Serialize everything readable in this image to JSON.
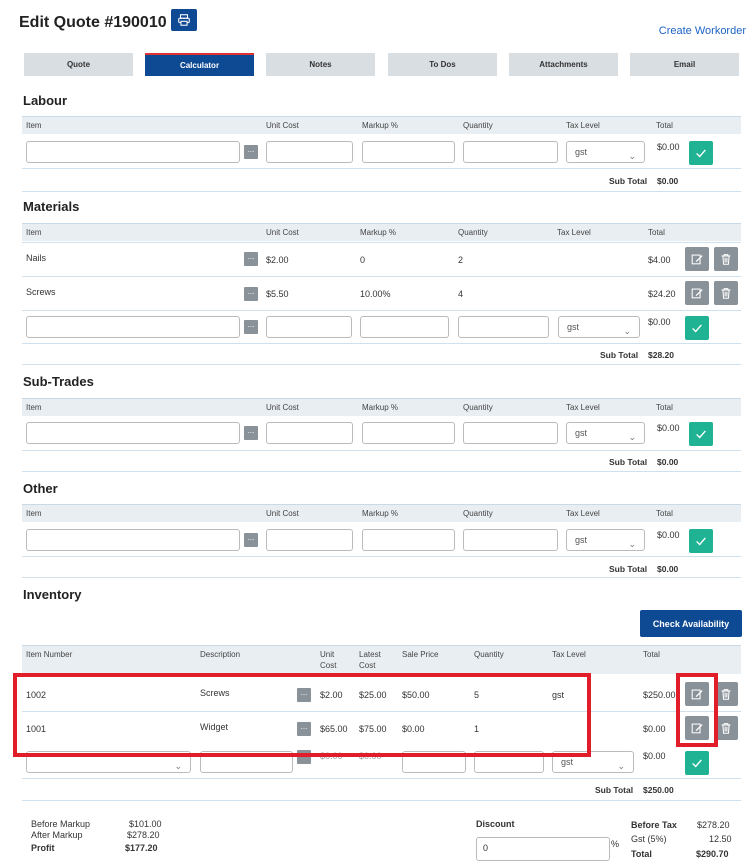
{
  "header": {
    "title": "Edit Quote #190010",
    "create_workorder": "Create Workorder"
  },
  "tabs": [
    "Quote",
    "Calculator",
    "Notes",
    "To Dos",
    "Attachments",
    "Email"
  ],
  "labour": {
    "title": "Labour",
    "cols": [
      "Item",
      "Unit Cost",
      "Markup %",
      "Quantity",
      "Tax Level",
      "Total"
    ],
    "new_row": {
      "tax": "gst",
      "total": "$0.00"
    },
    "subtotal_label": "Sub Total",
    "subtotal": "$0.00"
  },
  "materials": {
    "title": "Materials",
    "cols": [
      "Item",
      "Unit Cost",
      "Markup %",
      "Quantity",
      "Tax Level",
      "Total"
    ],
    "rows": [
      {
        "item": "Nails",
        "unit_cost": "$2.00",
        "markup": "0",
        "qty": "2",
        "total": "$4.00"
      },
      {
        "item": "Screws",
        "unit_cost": "$5.50",
        "markup": "10.00%",
        "qty": "4",
        "total": "$24.20"
      }
    ],
    "new_row": {
      "tax": "gst",
      "total": "$0.00"
    },
    "subtotal_label": "Sub Total",
    "subtotal": "$28.20"
  },
  "subtrades": {
    "title": "Sub-Trades",
    "cols": [
      "Item",
      "Unit Cost",
      "Markup %",
      "Quantity",
      "Tax Level",
      "Total"
    ],
    "new_row": {
      "tax": "gst",
      "total": "$0.00"
    },
    "subtotal_label": "Sub Total",
    "subtotal": "$0.00"
  },
  "other": {
    "title": "Other",
    "cols": [
      "Item",
      "Unit Cost",
      "Markup %",
      "Quantity",
      "Tax Level",
      "Total"
    ],
    "new_row": {
      "tax": "gst",
      "total": "$0.00"
    },
    "subtotal_label": "Sub Total",
    "subtotal": "$0.00"
  },
  "inventory": {
    "title": "Inventory",
    "check_availability": "Check Availability",
    "cols": {
      "item_number": "Item Number",
      "description": "Description",
      "unit_cost_1": "Unit",
      "unit_cost_2": "Cost",
      "latest_cost_1": "Latest",
      "latest_cost_2": "Cost",
      "sale_price": "Sale Price",
      "quantity": "Quantity",
      "tax_level": "Tax Level",
      "total": "Total"
    },
    "rows": [
      {
        "item_number": "1002",
        "description": "Screws",
        "unit_cost": "$2.00",
        "latest_cost": "$25.00",
        "sale_price": "$50.00",
        "qty": "5",
        "tax": "gst",
        "total": "$250.00"
      },
      {
        "item_number": "1001",
        "description": "Widget",
        "unit_cost": "$65.00",
        "latest_cost": "$75.00",
        "sale_price": "$0.00",
        "qty": "1",
        "tax": "",
        "total": "$0.00"
      }
    ],
    "new_row": {
      "unit_cost": "$0.00",
      "latest_cost": "$0.00",
      "tax": "gst",
      "total": "$0.00"
    },
    "subtotal_label": "Sub Total",
    "subtotal": "$250.00"
  },
  "summary": {
    "before_markup_label": "Before Markup",
    "before_markup": "$101.00",
    "after_markup_label": "After Markup",
    "after_markup": "$278.20",
    "profit_label": "Profit",
    "profit": "$177.20",
    "discount_label": "Discount",
    "discount_value": "0",
    "discount_unit": "%",
    "before_tax_label": "Before Tax",
    "before_tax": "$278.20",
    "gst_label": "Gst (5%)",
    "gst": "12.50",
    "total_label": "Total",
    "total": "$290.70"
  },
  "colors": {
    "primary": "#0e4a93",
    "confirm": "#1fb393",
    "highlight": "#e11d2a",
    "secondary": "#8a9299"
  }
}
